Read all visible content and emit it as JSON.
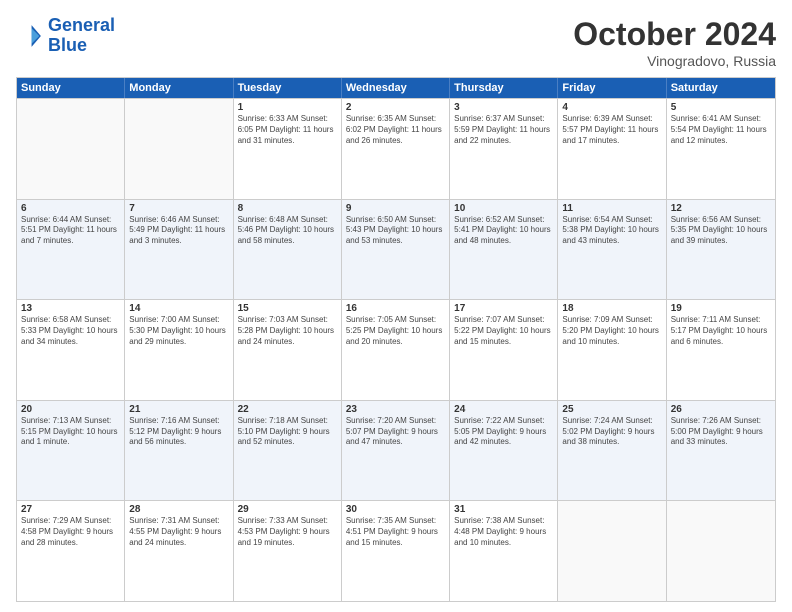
{
  "logo": {
    "line1": "General",
    "line2": "Blue"
  },
  "title": "October 2024",
  "location": "Vinogradovo, Russia",
  "header_days": [
    "Sunday",
    "Monday",
    "Tuesday",
    "Wednesday",
    "Thursday",
    "Friday",
    "Saturday"
  ],
  "weeks": [
    [
      {
        "day": "",
        "info": ""
      },
      {
        "day": "",
        "info": ""
      },
      {
        "day": "1",
        "info": "Sunrise: 6:33 AM\nSunset: 6:05 PM\nDaylight: 11 hours and 31 minutes."
      },
      {
        "day": "2",
        "info": "Sunrise: 6:35 AM\nSunset: 6:02 PM\nDaylight: 11 hours and 26 minutes."
      },
      {
        "day": "3",
        "info": "Sunrise: 6:37 AM\nSunset: 5:59 PM\nDaylight: 11 hours and 22 minutes."
      },
      {
        "day": "4",
        "info": "Sunrise: 6:39 AM\nSunset: 5:57 PM\nDaylight: 11 hours and 17 minutes."
      },
      {
        "day": "5",
        "info": "Sunrise: 6:41 AM\nSunset: 5:54 PM\nDaylight: 11 hours and 12 minutes."
      }
    ],
    [
      {
        "day": "6",
        "info": "Sunrise: 6:44 AM\nSunset: 5:51 PM\nDaylight: 11 hours and 7 minutes."
      },
      {
        "day": "7",
        "info": "Sunrise: 6:46 AM\nSunset: 5:49 PM\nDaylight: 11 hours and 3 minutes."
      },
      {
        "day": "8",
        "info": "Sunrise: 6:48 AM\nSunset: 5:46 PM\nDaylight: 10 hours and 58 minutes."
      },
      {
        "day": "9",
        "info": "Sunrise: 6:50 AM\nSunset: 5:43 PM\nDaylight: 10 hours and 53 minutes."
      },
      {
        "day": "10",
        "info": "Sunrise: 6:52 AM\nSunset: 5:41 PM\nDaylight: 10 hours and 48 minutes."
      },
      {
        "day": "11",
        "info": "Sunrise: 6:54 AM\nSunset: 5:38 PM\nDaylight: 10 hours and 43 minutes."
      },
      {
        "day": "12",
        "info": "Sunrise: 6:56 AM\nSunset: 5:35 PM\nDaylight: 10 hours and 39 minutes."
      }
    ],
    [
      {
        "day": "13",
        "info": "Sunrise: 6:58 AM\nSunset: 5:33 PM\nDaylight: 10 hours and 34 minutes."
      },
      {
        "day": "14",
        "info": "Sunrise: 7:00 AM\nSunset: 5:30 PM\nDaylight: 10 hours and 29 minutes."
      },
      {
        "day": "15",
        "info": "Sunrise: 7:03 AM\nSunset: 5:28 PM\nDaylight: 10 hours and 24 minutes."
      },
      {
        "day": "16",
        "info": "Sunrise: 7:05 AM\nSunset: 5:25 PM\nDaylight: 10 hours and 20 minutes."
      },
      {
        "day": "17",
        "info": "Sunrise: 7:07 AM\nSunset: 5:22 PM\nDaylight: 10 hours and 15 minutes."
      },
      {
        "day": "18",
        "info": "Sunrise: 7:09 AM\nSunset: 5:20 PM\nDaylight: 10 hours and 10 minutes."
      },
      {
        "day": "19",
        "info": "Sunrise: 7:11 AM\nSunset: 5:17 PM\nDaylight: 10 hours and 6 minutes."
      }
    ],
    [
      {
        "day": "20",
        "info": "Sunrise: 7:13 AM\nSunset: 5:15 PM\nDaylight: 10 hours and 1 minute."
      },
      {
        "day": "21",
        "info": "Sunrise: 7:16 AM\nSunset: 5:12 PM\nDaylight: 9 hours and 56 minutes."
      },
      {
        "day": "22",
        "info": "Sunrise: 7:18 AM\nSunset: 5:10 PM\nDaylight: 9 hours and 52 minutes."
      },
      {
        "day": "23",
        "info": "Sunrise: 7:20 AM\nSunset: 5:07 PM\nDaylight: 9 hours and 47 minutes."
      },
      {
        "day": "24",
        "info": "Sunrise: 7:22 AM\nSunset: 5:05 PM\nDaylight: 9 hours and 42 minutes."
      },
      {
        "day": "25",
        "info": "Sunrise: 7:24 AM\nSunset: 5:02 PM\nDaylight: 9 hours and 38 minutes."
      },
      {
        "day": "26",
        "info": "Sunrise: 7:26 AM\nSunset: 5:00 PM\nDaylight: 9 hours and 33 minutes."
      }
    ],
    [
      {
        "day": "27",
        "info": "Sunrise: 7:29 AM\nSunset: 4:58 PM\nDaylight: 9 hours and 28 minutes."
      },
      {
        "day": "28",
        "info": "Sunrise: 7:31 AM\nSunset: 4:55 PM\nDaylight: 9 hours and 24 minutes."
      },
      {
        "day": "29",
        "info": "Sunrise: 7:33 AM\nSunset: 4:53 PM\nDaylight: 9 hours and 19 minutes."
      },
      {
        "day": "30",
        "info": "Sunrise: 7:35 AM\nSunset: 4:51 PM\nDaylight: 9 hours and 15 minutes."
      },
      {
        "day": "31",
        "info": "Sunrise: 7:38 AM\nSunset: 4:48 PM\nDaylight: 9 hours and 10 minutes."
      },
      {
        "day": "",
        "info": ""
      },
      {
        "day": "",
        "info": ""
      }
    ]
  ]
}
